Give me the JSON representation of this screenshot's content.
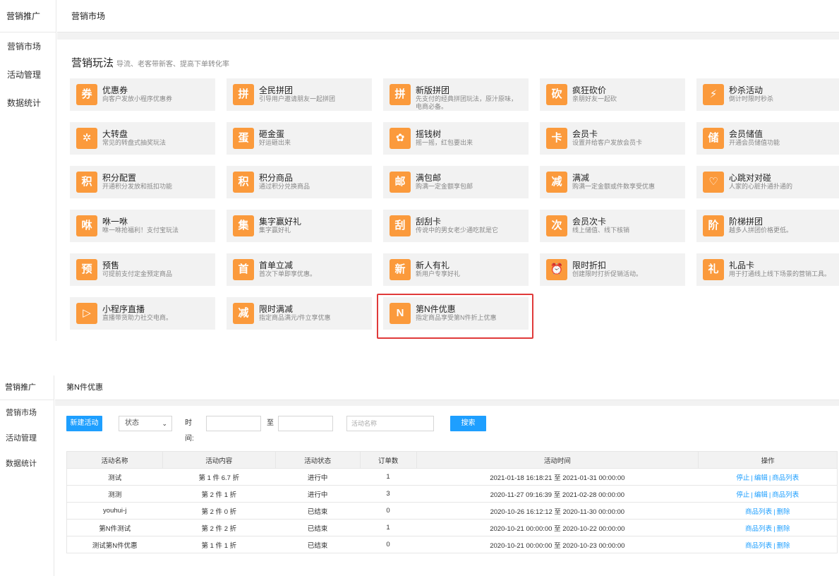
{
  "top": {
    "sidebar": {
      "title": "营销推广",
      "items": [
        "营销市场",
        "活动管理",
        "数据统计"
      ]
    },
    "header": "营销市场",
    "section": {
      "title": "营销玩法",
      "subtitle": "导流、老客带新客、提高下单转化率"
    },
    "cards": [
      {
        "icon": "coupon-icon",
        "glyph": "券",
        "title": "优惠券",
        "desc": "向客户发放小程序优惠券"
      },
      {
        "icon": "group-buy-icon",
        "glyph": "拼",
        "title": "全民拼团",
        "desc": "引导用户邀请朋友一起拼团"
      },
      {
        "icon": "new-group-buy-icon",
        "glyph": "拼",
        "title": "新版拼团",
        "desc": "先支付的经典拼团玩法，原汁原味，电商必备。"
      },
      {
        "icon": "bargain-icon",
        "glyph": "砍",
        "title": "疯狂砍价",
        "desc": "亲朋好友一起砍"
      },
      {
        "icon": "flash-sale-icon",
        "glyph": "⚡",
        "title": "秒杀活动",
        "desc": "倒计时限时秒杀"
      },
      {
        "icon": "lucky-wheel-icon",
        "glyph": "✲",
        "title": "大转盘",
        "desc": "常见的转盘式抽奖玩法"
      },
      {
        "icon": "golden-egg-icon",
        "glyph": "蛋",
        "title": "砸金蛋",
        "desc": "好运砸出来"
      },
      {
        "icon": "money-tree-icon",
        "glyph": "✿",
        "title": "摇钱树",
        "desc": "摇一摇，红包要出来"
      },
      {
        "icon": "member-card-icon",
        "glyph": "卡",
        "title": "会员卡",
        "desc": "设置并给客户发放会员卡"
      },
      {
        "icon": "member-deposit-icon",
        "glyph": "储",
        "title": "会员储值",
        "desc": "开通会员储值功能"
      },
      {
        "icon": "points-config-icon",
        "glyph": "积",
        "title": "积分配置",
        "desc": "开通积分发放和抵扣功能"
      },
      {
        "icon": "points-goods-icon",
        "glyph": "积",
        "title": "积分商品",
        "desc": "通过积分兑换商品"
      },
      {
        "icon": "free-shipping-icon",
        "glyph": "邮",
        "title": "满包邮",
        "desc": "购满一定金额享包邮"
      },
      {
        "icon": "full-reduction-icon",
        "glyph": "减",
        "title": "满减",
        "desc": "购满一定金额或件数享受优惠"
      },
      {
        "icon": "heartbeat-icon",
        "glyph": "♡",
        "title": "心跳对对碰",
        "desc": "人家的心脏扑通扑通的"
      },
      {
        "icon": "sniff-icon",
        "glyph": "咻",
        "title": "咻一咻",
        "desc": "咻一咻抢福利！支付宝玩法"
      },
      {
        "icon": "collect-words-icon",
        "glyph": "集",
        "title": "集字赢好礼",
        "desc": "集字赢好礼"
      },
      {
        "icon": "scratch-card-icon",
        "glyph": "刮",
        "title": "刮刮卡",
        "desc": "传说中的男女老少通吃就是它"
      },
      {
        "icon": "times-card-icon",
        "glyph": "次",
        "title": "会员次卡",
        "desc": "线上储值、线下核销"
      },
      {
        "icon": "ladder-group-icon",
        "glyph": "阶",
        "title": "阶梯拼团",
        "desc": "越多人拼团价格更低。"
      },
      {
        "icon": "presale-icon",
        "glyph": "预",
        "title": "预售",
        "desc": "可提前支付定金预定商品"
      },
      {
        "icon": "first-order-icon",
        "glyph": "首",
        "title": "首单立减",
        "desc": "首次下单即享优惠。"
      },
      {
        "icon": "new-user-gift-icon",
        "glyph": "新",
        "title": "新人有礼",
        "desc": "新用户专享好礼"
      },
      {
        "icon": "time-discount-icon",
        "glyph": "⏰",
        "title": "限时折扣",
        "desc": "创建限时打折促销活动。"
      },
      {
        "icon": "gift-card-icon",
        "glyph": "礼",
        "title": "礼品卡",
        "desc": "用于打通线上线下场景的营销工具。"
      },
      {
        "icon": "live-stream-icon",
        "glyph": "▷",
        "title": "小程序直播",
        "desc": "直播带货助力社交电商。"
      },
      {
        "icon": "limited-reduction-icon",
        "glyph": "减",
        "title": "限时满减",
        "desc": "指定商品满元/件立享优惠"
      },
      {
        "icon": "nth-discount-icon",
        "glyph": "N",
        "title": "第N件优惠",
        "desc": "指定商品享受第N件折上优惠"
      }
    ]
  },
  "bottom": {
    "sidebar": {
      "title": "营销推广",
      "items": [
        "营销市场",
        "活动管理",
        "数据统计"
      ]
    },
    "header": "第N件优惠",
    "toolbar": {
      "new_button": "新建活动",
      "status_select": "状态",
      "time_label": "时间:",
      "to_label": "至",
      "name_placeholder": "活动名称",
      "search_button": "搜索"
    },
    "table": {
      "headers": [
        "活动名称",
        "活动内容",
        "活动状态",
        "订单数",
        "活动时间",
        "操作"
      ],
      "rows": [
        {
          "name": "测试",
          "content": "第 1 件 6.7 折",
          "status": "进行中",
          "orders": "1",
          "time": "2021-01-18 16:18:21 至 2021-01-31 00:00:00",
          "actions": [
            "停止",
            "编辑",
            "商品列表"
          ]
        },
        {
          "name": "测测",
          "content": "第 2 件 1 折",
          "status": "进行中",
          "orders": "3",
          "time": "2020-11-27 09:16:39 至 2021-02-28 00:00:00",
          "actions": [
            "停止",
            "编辑",
            "商品列表"
          ]
        },
        {
          "name": "youhui-j",
          "content": "第 2 件 0 折",
          "status": "已结束",
          "orders": "0",
          "time": "2020-10-26 16:12:12 至 2020-11-30 00:00:00",
          "actions": [
            "商品列表",
            "删除"
          ]
        },
        {
          "name": "第N件测试",
          "content": "第 2 件 2 折",
          "status": "已结束",
          "orders": "1",
          "time": "2020-10-21 00:00:00 至 2020-10-22 00:00:00",
          "actions": [
            "商品列表",
            "删除"
          ]
        },
        {
          "name": "测试第N件优惠",
          "content": "第 1 件 1 折",
          "status": "已结束",
          "orders": "0",
          "time": "2020-10-21 00:00:00 至 2020-10-23 00:00:00",
          "actions": [
            "商品列表",
            "删除"
          ]
        }
      ]
    }
  },
  "colors": {
    "accent": "#1e9fff",
    "icon_bg": "#fb9a3c",
    "highlight": "#e03a3a",
    "card_bg": "#f2f2f2"
  }
}
